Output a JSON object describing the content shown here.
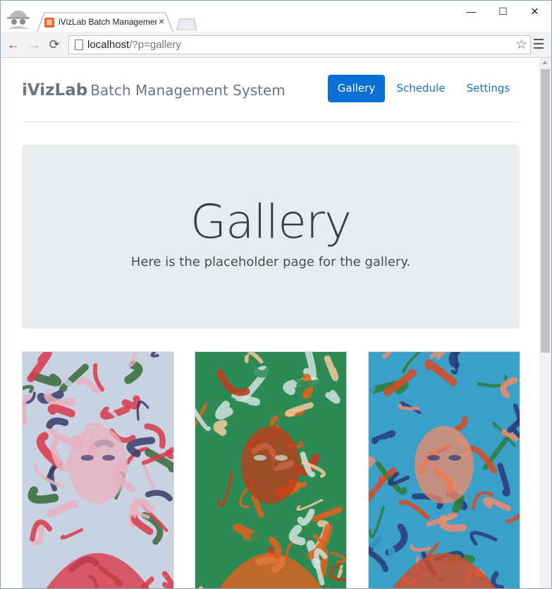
{
  "browser": {
    "tab_title": "iVizLab Batch Managemen",
    "tab_close": "×",
    "favicon_label": "☒",
    "url_host": "localhost",
    "url_path": "/?p=gallery",
    "back": "←",
    "forward": "→",
    "reload": "⟳",
    "star": "☆",
    "minimize": "—",
    "maximize": "☐",
    "close": "✕"
  },
  "site": {
    "brand_bold": "iVizLab",
    "brand_rest": "Batch Management System",
    "nav": [
      {
        "label": "Gallery",
        "active": true
      },
      {
        "label": "Schedule",
        "active": false
      },
      {
        "label": "Settings",
        "active": false
      }
    ]
  },
  "hero": {
    "title": "Gallery",
    "subtitle": "Here is the placeholder page for the gallery."
  },
  "gallery": {
    "images": [
      {
        "name": "psychedelic-portrait-1",
        "colors": [
          "#d93a4a",
          "#c9d2e0",
          "#3a6a3a",
          "#e9b0c0",
          "#3b3b6b"
        ]
      },
      {
        "name": "psychedelic-portrait-2",
        "colors": [
          "#e0601f",
          "#2e8a55",
          "#f2c9a0",
          "#c33a1a",
          "#cfe3df"
        ]
      },
      {
        "name": "psychedelic-portrait-3",
        "colors": [
          "#d84a25",
          "#3aa0c8",
          "#2f7d3a",
          "#f08a6a",
          "#2a3a7a"
        ]
      }
    ]
  }
}
